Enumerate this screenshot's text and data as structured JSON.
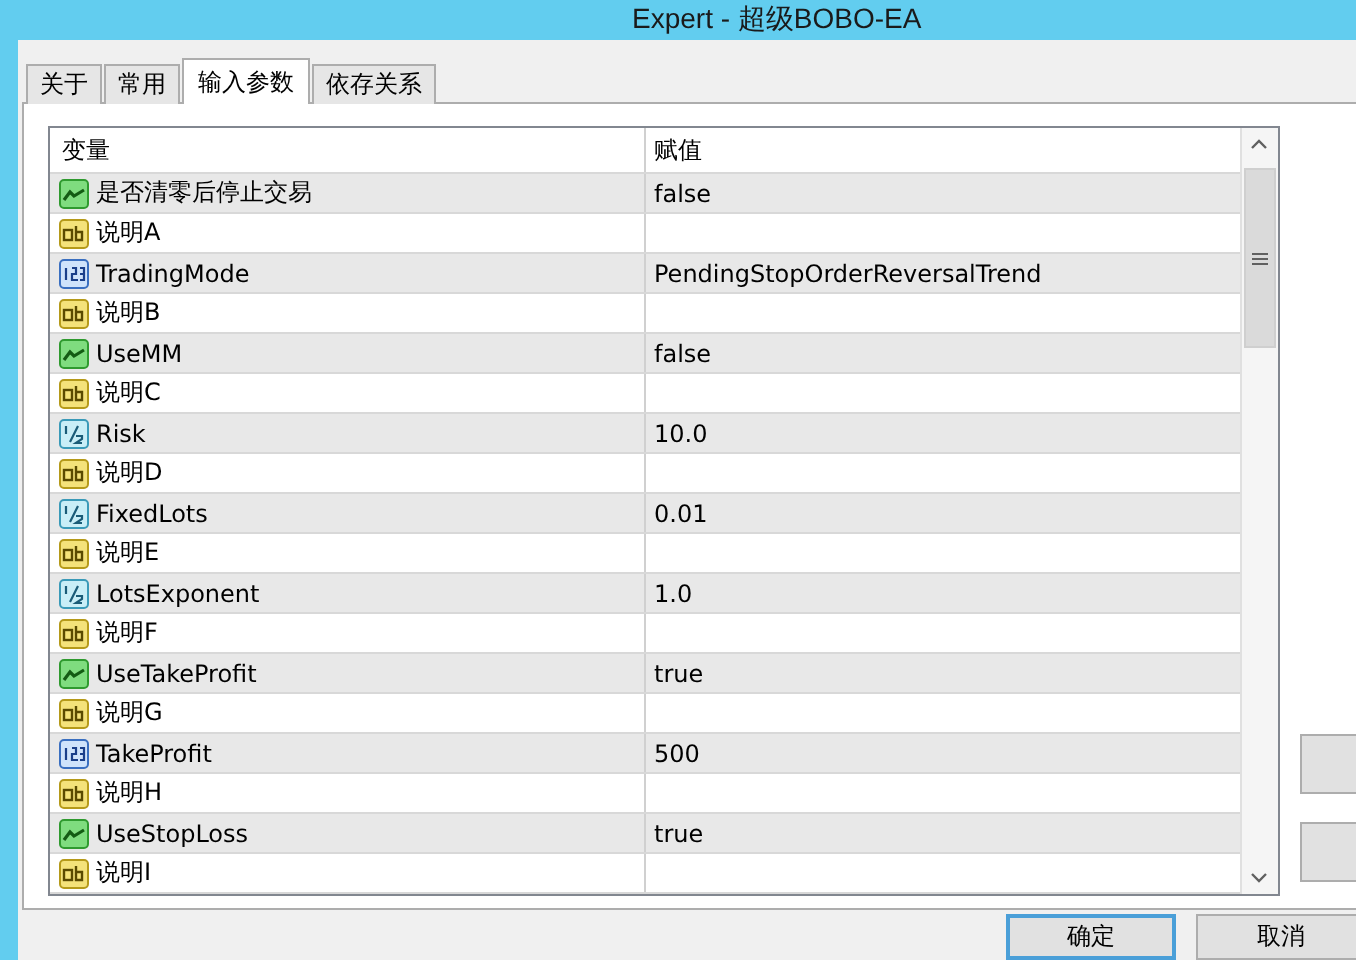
{
  "window": {
    "title": "Expert - 超级BOBO-EA"
  },
  "tabs": [
    {
      "label": "关于",
      "selected": false
    },
    {
      "label": "常用",
      "selected": false
    },
    {
      "label": "输入参数",
      "selected": true
    },
    {
      "label": "依存关系",
      "selected": false
    }
  ],
  "table": {
    "columns": [
      "变量",
      "赋值"
    ],
    "rows": [
      {
        "kind": "bool",
        "name": "是否清零后停止交易",
        "value": "false"
      },
      {
        "kind": "string",
        "name": "说明A"
      },
      {
        "kind": "int",
        "name": "TradingMode",
        "value": "PendingStopOrderReversalTrend"
      },
      {
        "kind": "string",
        "name": "说明B"
      },
      {
        "kind": "bool",
        "name": "UseMM",
        "value": "false"
      },
      {
        "kind": "string",
        "name": "说明C"
      },
      {
        "kind": "double",
        "name": "Risk",
        "value": "10.0"
      },
      {
        "kind": "string",
        "name": "说明D"
      },
      {
        "kind": "double",
        "name": "FixedLots",
        "value": "0.01"
      },
      {
        "kind": "string",
        "name": "说明E"
      },
      {
        "kind": "double",
        "name": "LotsExponent",
        "value": "1.0"
      },
      {
        "kind": "string",
        "name": "说明F"
      },
      {
        "kind": "bool",
        "name": "UseTakeProfit",
        "value": "true"
      },
      {
        "kind": "string",
        "name": "说明G"
      },
      {
        "kind": "int",
        "name": "TakeProfit",
        "value": "500"
      },
      {
        "kind": "string",
        "name": "说明H"
      },
      {
        "kind": "bool",
        "name": "UseStopLoss",
        "value": "true"
      },
      {
        "kind": "string",
        "name": "说明I"
      }
    ]
  },
  "buttons": [
    {
      "label": "确定",
      "default": true
    },
    {
      "label": "取消",
      "default": false
    }
  ]
}
